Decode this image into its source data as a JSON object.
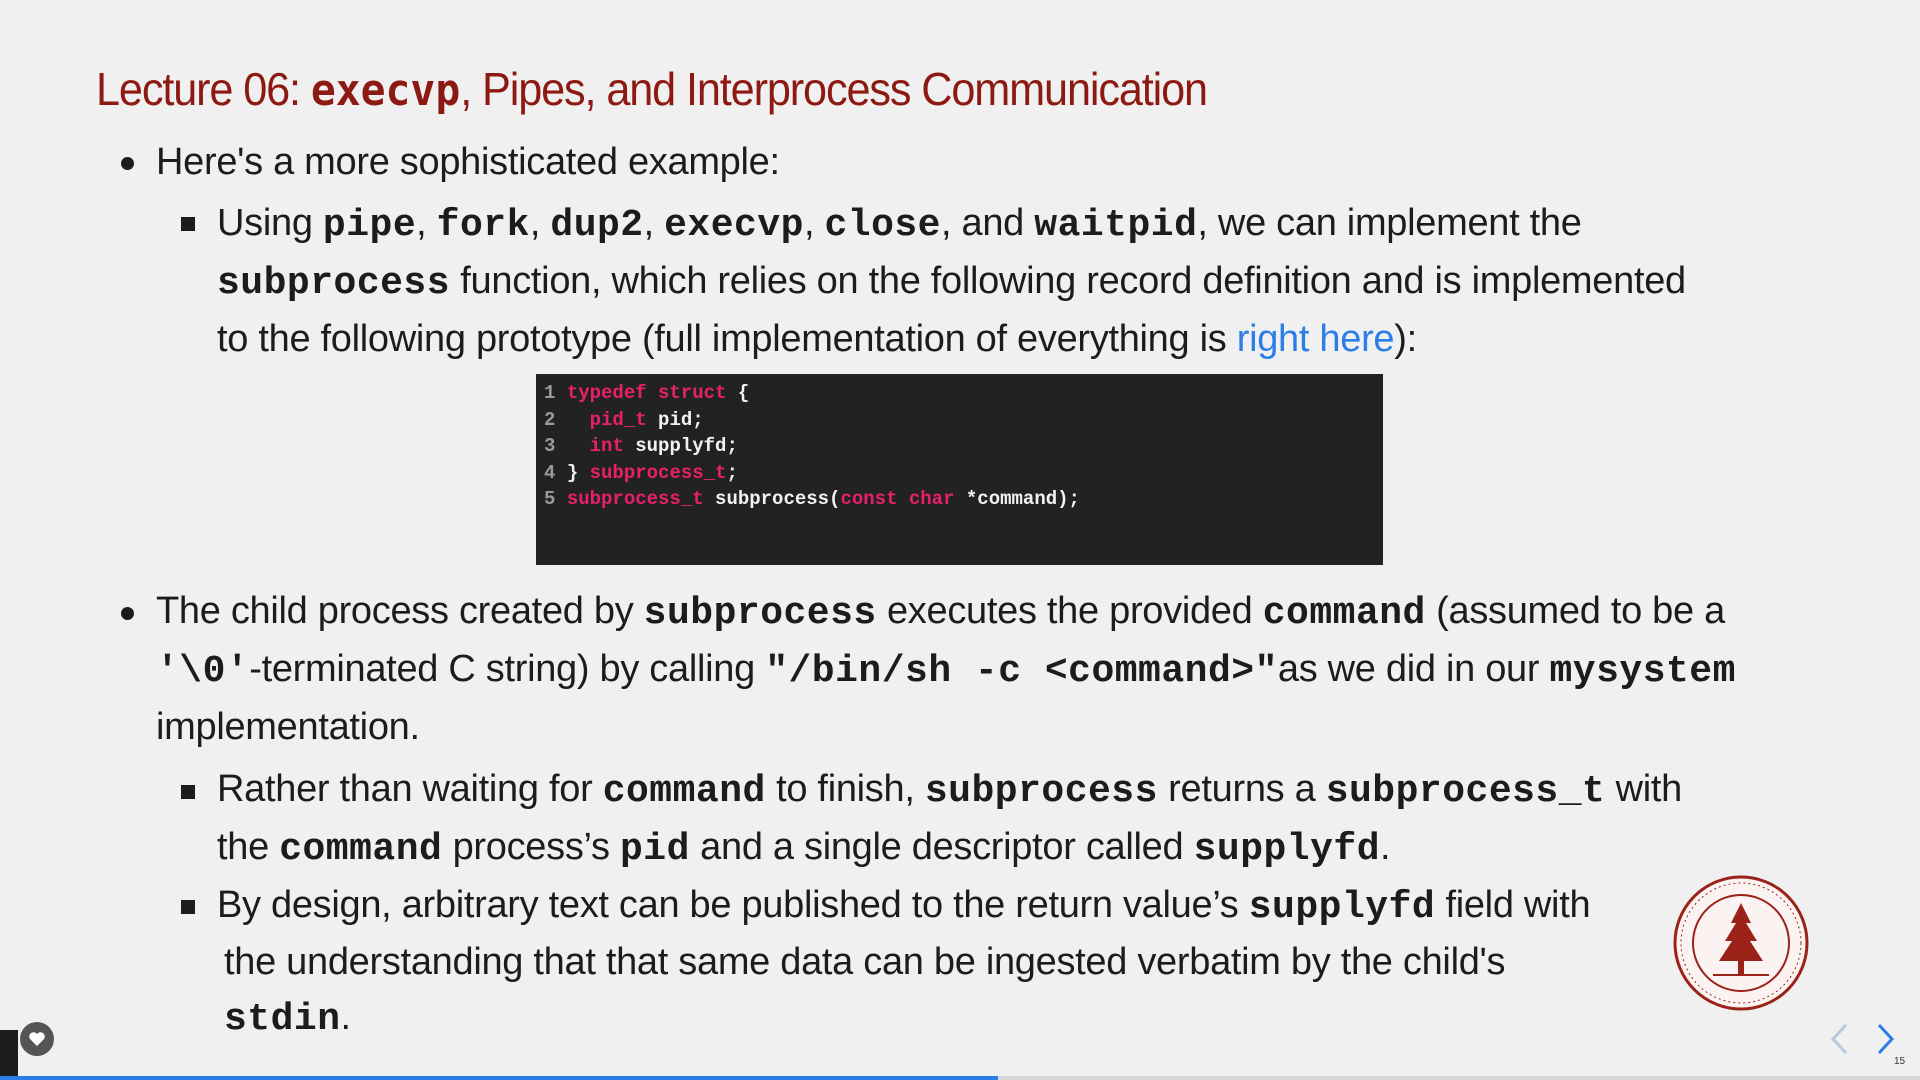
{
  "slide": {
    "title_pre": "Lecture 06: ",
    "title_code": "execvp",
    "title_post": ", Pipes, and Interprocess Communication",
    "b1": {
      "text": "Here's a more sophisticated example:"
    },
    "s1": {
      "l1": [
        {
          "t": "Using "
        },
        {
          "c": "pipe"
        },
        {
          "t": ", "
        },
        {
          "c": "fork"
        },
        {
          "t": ", "
        },
        {
          "c": "dup2"
        },
        {
          "t": ", "
        },
        {
          "c": "execvp"
        },
        {
          "t": ", "
        },
        {
          "c": "close"
        },
        {
          "t": ", and "
        },
        {
          "c": "waitpid"
        },
        {
          "t": ", we can implement the"
        }
      ],
      "l2": [
        {
          "c": "subprocess"
        },
        {
          "t": "  function, which relies on the following record definition and is implemented"
        }
      ],
      "l3": [
        {
          "t": "to the following prototype (full implementation of everything is "
        },
        {
          "l": "right here"
        },
        {
          "t": "):"
        }
      ]
    },
    "code": {
      "lines": [
        {
          "n": "1",
          "parts": [
            {
              "k": "typedef struct"
            },
            {
              "p": " {"
            }
          ]
        },
        {
          "n": "2",
          "parts": [
            {
              "p": "  "
            },
            {
              "k": "pid_t"
            },
            {
              "p": " pid;"
            }
          ]
        },
        {
          "n": "3",
          "parts": [
            {
              "p": "  "
            },
            {
              "k": "int"
            },
            {
              "p": " supplyfd;"
            }
          ]
        },
        {
          "n": "4",
          "parts": [
            {
              "p": "} "
            },
            {
              "k": "subprocess_t"
            },
            {
              "p": ";"
            }
          ]
        },
        {
          "n": "5",
          "parts": [
            {
              "k": "subprocess_t"
            },
            {
              "p": " subprocess("
            },
            {
              "k": "const char"
            },
            {
              "p": " *command);"
            }
          ]
        }
      ]
    },
    "b2": {
      "l1": [
        {
          "t": "The child process created by "
        },
        {
          "c": "subprocess"
        },
        {
          "t": "  executes the provided "
        },
        {
          "c": "command"
        },
        {
          "t": "  (assumed to be a"
        }
      ],
      "l2": [
        {
          "c": "'\\0'"
        },
        {
          "t": "-terminated C string) by calling "
        },
        {
          "c": "\"/bin/sh -c <command>\""
        },
        {
          "t": "as we did in our "
        },
        {
          "c": "mysystem"
        }
      ],
      "l3": [
        {
          "t": "implementation."
        }
      ]
    },
    "s2": {
      "l1": [
        {
          "t": "Rather than waiting for "
        },
        {
          "c": "command"
        },
        {
          "t": "  to finish, "
        },
        {
          "c": "subprocess"
        },
        {
          "t": "  returns a "
        },
        {
          "c": "subprocess_t"
        },
        {
          "t": "  with"
        }
      ],
      "l2": [
        {
          "t": "the "
        },
        {
          "c": "command"
        },
        {
          "t": "  process’s "
        },
        {
          "c": "pid"
        },
        {
          "t": "  and a single descriptor called "
        },
        {
          "c": "supplyfd"
        },
        {
          "t": "."
        }
      ]
    },
    "s3": {
      "l1": [
        {
          "t": "By design, arbitrary text can be published to the return value’s "
        },
        {
          "c": "supplyfd"
        },
        {
          "t": "  field with"
        }
      ],
      "l2": [
        {
          "t": "the understanding that that same data can be ingested verbatim by the child's"
        }
      ],
      "l3": [
        {
          "c": "stdin"
        },
        {
          "t": "."
        }
      ]
    }
  },
  "seal": {
    "text": "LELAND STANFORD JUNIOR UNIVERSITY",
    "year": "1891"
  },
  "nav": {
    "page_number": "15",
    "progress": 0.52
  },
  "colors": {
    "title": "#8c1a12",
    "link": "#2a7ee6",
    "keyword": "#e8206a",
    "code_bg": "#222222"
  }
}
